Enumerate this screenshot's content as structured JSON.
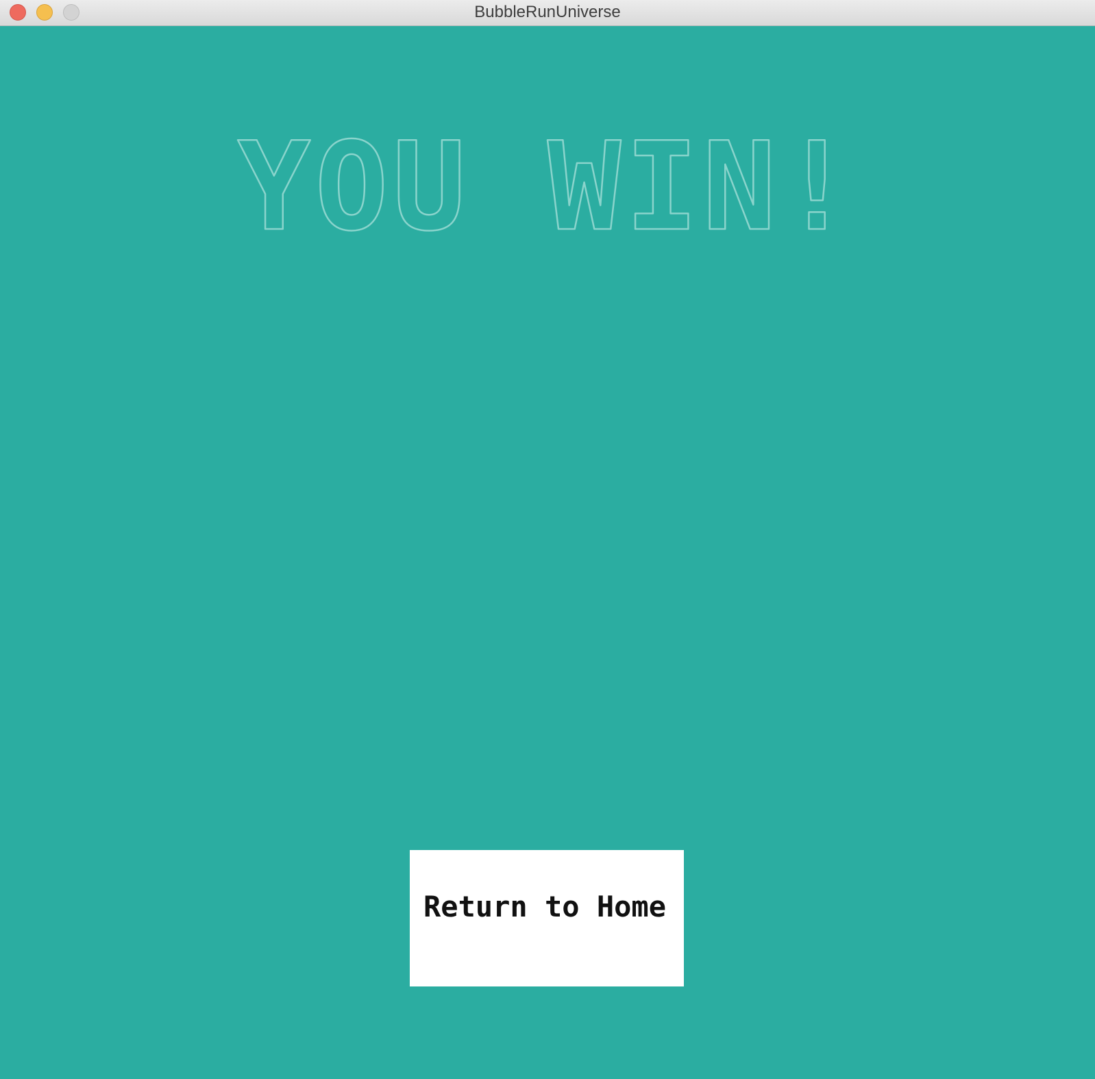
{
  "window": {
    "title": "BubbleRunUniverse"
  },
  "screen": {
    "headline": "YOU WIN!",
    "home_button_label": "Return to Home"
  },
  "colors": {
    "background": "#2bada1",
    "headline_outline": "#8ad4cc",
    "button_background": "#ffffff",
    "button_text": "#111111"
  }
}
